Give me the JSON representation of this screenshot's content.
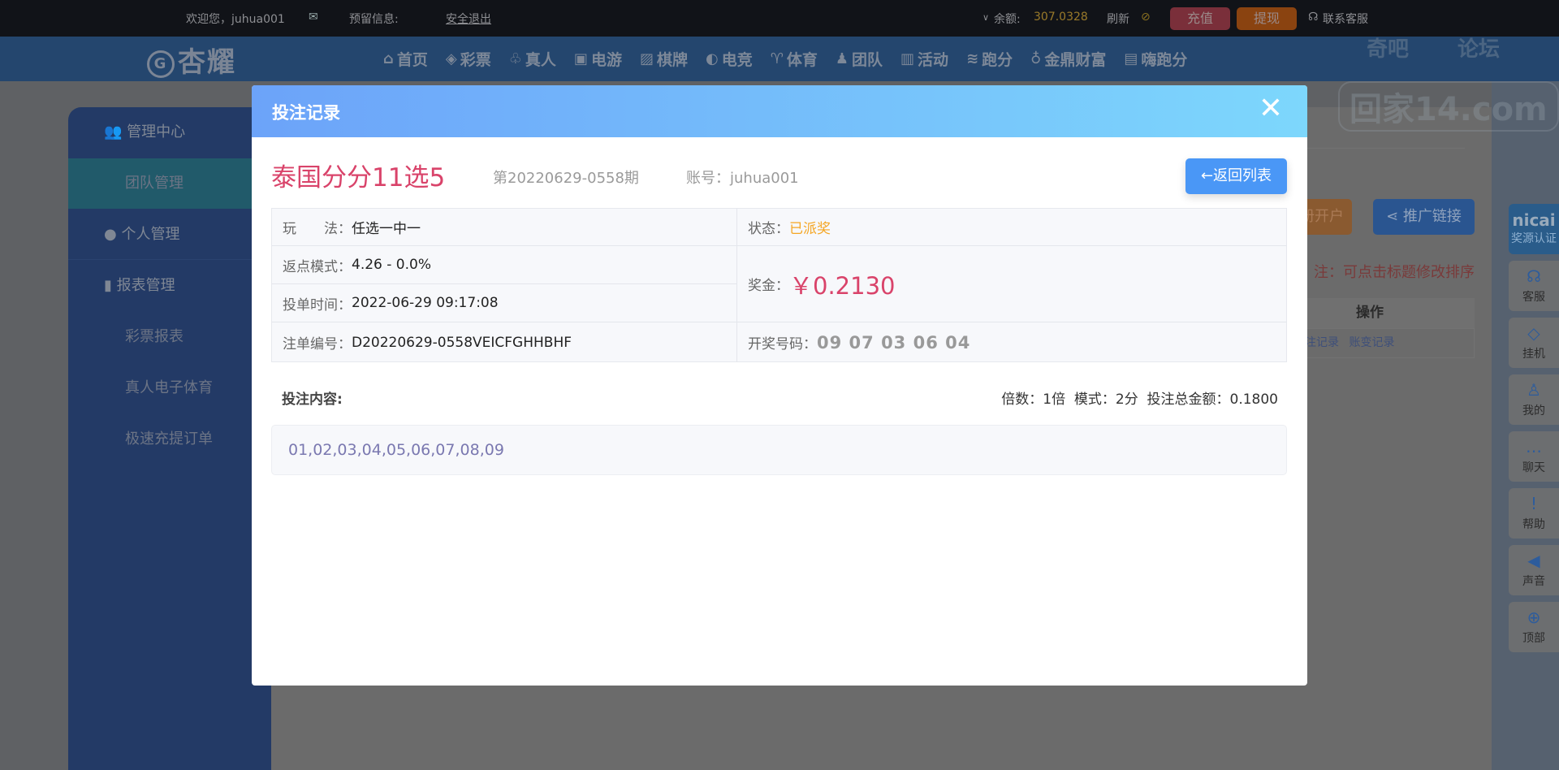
{
  "topbar": {
    "welcome": "欢迎您，juhua001",
    "mail_icon": "envelope-icon",
    "reserved_info": "预留信息:",
    "logout": "安全退出",
    "balance_label": "余额:",
    "balance": "307.0328",
    "refresh": "刷新",
    "recharge": "充值",
    "withdraw": "提现",
    "support": "联系客服",
    "colors": {
      "recharge": "#7a2f3a",
      "withdraw": "#8a4310",
      "balance": "#9a7a2a"
    }
  },
  "nav": {
    "logo": "杏耀",
    "items": [
      {
        "icon": "home-icon",
        "label": "首页"
      },
      {
        "icon": "lottery-icon",
        "label": "彩票"
      },
      {
        "icon": "live-icon",
        "label": "真人"
      },
      {
        "icon": "slot-icon",
        "label": "电游"
      },
      {
        "icon": "cards-icon",
        "label": "棋牌"
      },
      {
        "icon": "gamepad-icon",
        "label": "电竞"
      },
      {
        "icon": "trophy-icon",
        "label": "体育"
      },
      {
        "icon": "team-icon",
        "label": "团队"
      },
      {
        "icon": "gift-icon",
        "label": "活动"
      },
      {
        "icon": "runner-icon",
        "label": "跑分"
      },
      {
        "icon": "cauldron-icon",
        "label": "金鼎财富"
      },
      {
        "icon": "hi-icon",
        "label": "嗨跑分"
      }
    ]
  },
  "watermark": {
    "line1a": "奇吧",
    "line1b": "论坛",
    "line2": "回家14.com"
  },
  "sidebar": {
    "sections": [
      {
        "label": "管理中心",
        "icon": "users-icon"
      },
      {
        "label": "个人管理",
        "icon": "user-icon"
      },
      {
        "label": "报表管理",
        "icon": "report-icon"
      }
    ],
    "items": [
      "团队管理",
      "彩票报表",
      "真人电子体育",
      "极速充提订单"
    ]
  },
  "background": {
    "register_btn": "册开户",
    "promo_btn": "推广链接",
    "note": "注：可点击标题修改排序",
    "col_ops": "操作",
    "link_bets": "注记录",
    "link_account": "账变记录"
  },
  "modal": {
    "title": "投注记录",
    "lottery": "泰国分分11选5",
    "issue": "第20220629-0558期",
    "account": "账号：juhua001",
    "back": "返回列表",
    "rows": {
      "play_label": "玩　　法：",
      "play": "任选一中一",
      "status_label": "状态：",
      "status": "已派奖",
      "rebate_label": "返点模式：",
      "rebate": "4.26 - 0.0%",
      "time_label": "投单时间：",
      "time": "2022-06-29 09:17:08",
      "prize_label": "奖金：",
      "prize": "￥0.2130",
      "order_label": "注单编号：",
      "order": "D20220629-0558VEICFGHHBHF",
      "draw_label": "开奖号码：",
      "draw": "09 07 03 06 04"
    },
    "bet_content_label": "投注内容:",
    "summary": "倍数：1倍  模式：2分  投注总金额：0.1800",
    "numbers": "01,02,03,04,05,06,07,08,09",
    "colors": {
      "header_start": "#6ca3f9",
      "header_end": "#7dd7fc",
      "lottery": "#d9436a",
      "status": "#f5a623",
      "prize": "#d9436a"
    }
  },
  "floating": [
    {
      "label": "奖源认证",
      "logo": "nicai"
    },
    {
      "label": "客服",
      "icon": "headset-icon"
    },
    {
      "label": "挂机",
      "icon": "diamond-icon"
    },
    {
      "label": "我的",
      "icon": "user-icon"
    },
    {
      "label": "聊天",
      "icon": "chat-icon"
    },
    {
      "label": "帮助",
      "icon": "alert-icon"
    },
    {
      "label": "声音",
      "icon": "speaker-icon"
    },
    {
      "label": "顶部",
      "icon": "arrow-up-icon"
    }
  ]
}
